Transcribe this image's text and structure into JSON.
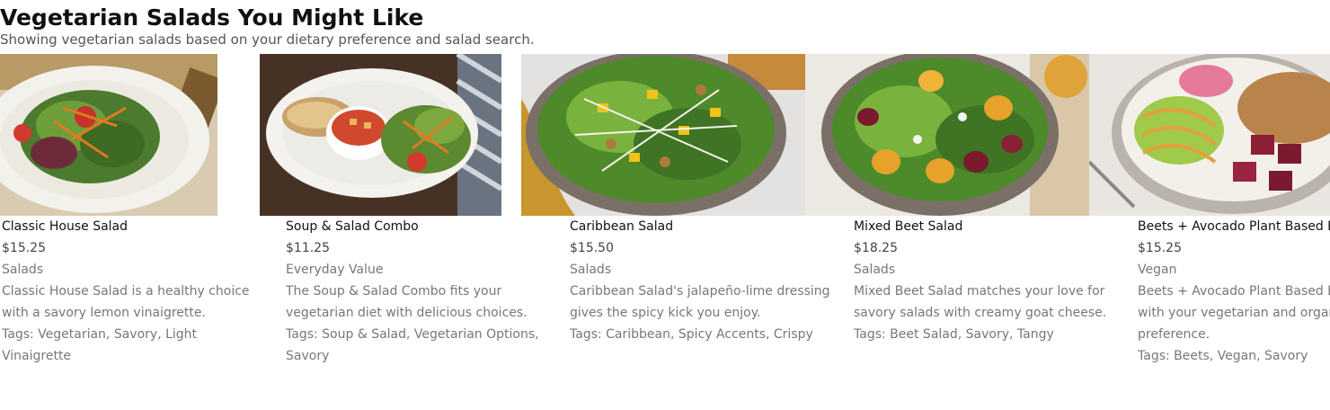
{
  "page": {
    "title": "Vegetarian Salads You Might Like",
    "subtitle": "Showing vegetarian salads based on your dietary preference and salad search."
  },
  "cards": [
    {
      "name": "Classic House Salad",
      "price": "$15.25",
      "category": "Salads",
      "desc_lines": [
        "Classic House Salad is a healthy choice",
        "with a savory lemon vinaigrette."
      ],
      "tags_lines": [
        "Tags: Vegetarian, Savory, Light",
        "Vinaigrette"
      ],
      "image": "classic-house-salad-photo"
    },
    {
      "name": "Soup & Salad Combo",
      "price": "$11.25",
      "category": "Everyday Value",
      "desc_lines": [
        "The Soup & Salad Combo fits your",
        "vegetarian diet with delicious choices."
      ],
      "tags_lines": [
        "Tags: Soup & Salad, Vegetarian Options,",
        "Savory"
      ],
      "image": "soup-salad-combo-photo"
    },
    {
      "name": "Caribbean Salad",
      "price": "$15.50",
      "category": "Salads",
      "desc_lines": [
        "Caribbean Salad's jalapeño-lime dressing",
        "gives the spicy kick you enjoy."
      ],
      "tags_lines": [
        "Tags: Caribbean, Spicy Accents, Crispy"
      ],
      "image": "caribbean-salad-photo"
    },
    {
      "name": "Mixed Beet Salad",
      "price": "$18.25",
      "category": "Salads",
      "desc_lines": [
        "Mixed Beet Salad matches your love for",
        "savory salads with creamy goat cheese."
      ],
      "tags_lines": [
        "Tags: Beet Salad, Savory, Tangy"
      ],
      "image": "mixed-beet-salad-photo"
    },
    {
      "name": "Beets + Avocado Plant Based Bowl",
      "price": "$15.25",
      "category": "Vegan",
      "desc_lines": [
        "Beets + Avocado Plant Based Bowl pairs",
        "with your vegetarian and organic",
        "preference."
      ],
      "tags_lines": [
        "Tags: Beets, Vegan, Savory"
      ],
      "image": "beets-avocado-bowl-photo"
    }
  ]
}
